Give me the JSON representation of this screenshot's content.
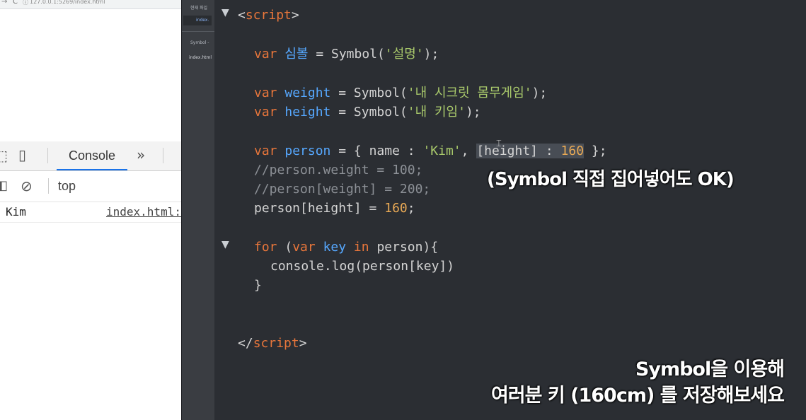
{
  "browser": {
    "url": "127.0.0.1:5269/index.html",
    "devtools": {
      "active_tab": "Console",
      "more_tabs_glyph": "»",
      "context": "top",
      "log_entries": [
        {
          "value": "Kim",
          "source": "index.html:"
        }
      ]
    }
  },
  "editor_sidebar": {
    "title": "현재 파일",
    "active_tab": "index.",
    "section_label": "Symbol -",
    "file_item": "index.html"
  },
  "code": {
    "open_tag": "script",
    "close_tag": "script",
    "line_symbol": {
      "kw": "var",
      "name": "심볼",
      "call": "Symbol(",
      "arg": "'설명'",
      "end": ");"
    },
    "line_weight": {
      "kw": "var",
      "name": "weight",
      "call": "Symbol(",
      "arg": "'내 시크릿 몸무게임'",
      "end": ");"
    },
    "line_height": {
      "kw": "var",
      "name": "height",
      "call": "Symbol(",
      "arg": "'내 키임'",
      "end": ");"
    },
    "line_person": {
      "kw": "var",
      "name": "person",
      "a": " = { name : ",
      "name_val": "'Kim'",
      "b": ", ",
      "computed": "[height] : ",
      "computed_val": "160",
      "end": " };"
    },
    "comment_1": "//person.weight = 100;",
    "comment_2": "//person[weight] = 200;",
    "assign": {
      "a": "person[height] = ",
      "val": "160",
      "end": ";"
    },
    "for_line": {
      "kw": "for",
      "open": " (",
      "kw2": "var",
      "key": "key",
      "kw3": "in",
      "rest": " person){"
    },
    "log_line": "console.log(person[key])",
    "close_brace": "}"
  },
  "annotation": "(Symbol 직접 집어넣어도 OK)",
  "captions": {
    "line1": "Symbol을 이용해",
    "line2": "여러분 키 (160cm) 를 저장해보세요"
  },
  "colors": {
    "editor_bg": "#2b2e33",
    "keyword": "#e8763b",
    "identifier": "#56a8ff",
    "string": "#a9c96b",
    "number": "#e8a955",
    "comment": "#8c9096",
    "console_tab_underline": "#1a73e8"
  },
  "icons": [
    "back-arrow-icon",
    "reload-icon",
    "info-icon",
    "inspect-icon",
    "device-toolbar-icon",
    "more-tabs-icon",
    "sidebar-toggle-icon",
    "clear-console-icon",
    "fold-arrow-icon"
  ]
}
